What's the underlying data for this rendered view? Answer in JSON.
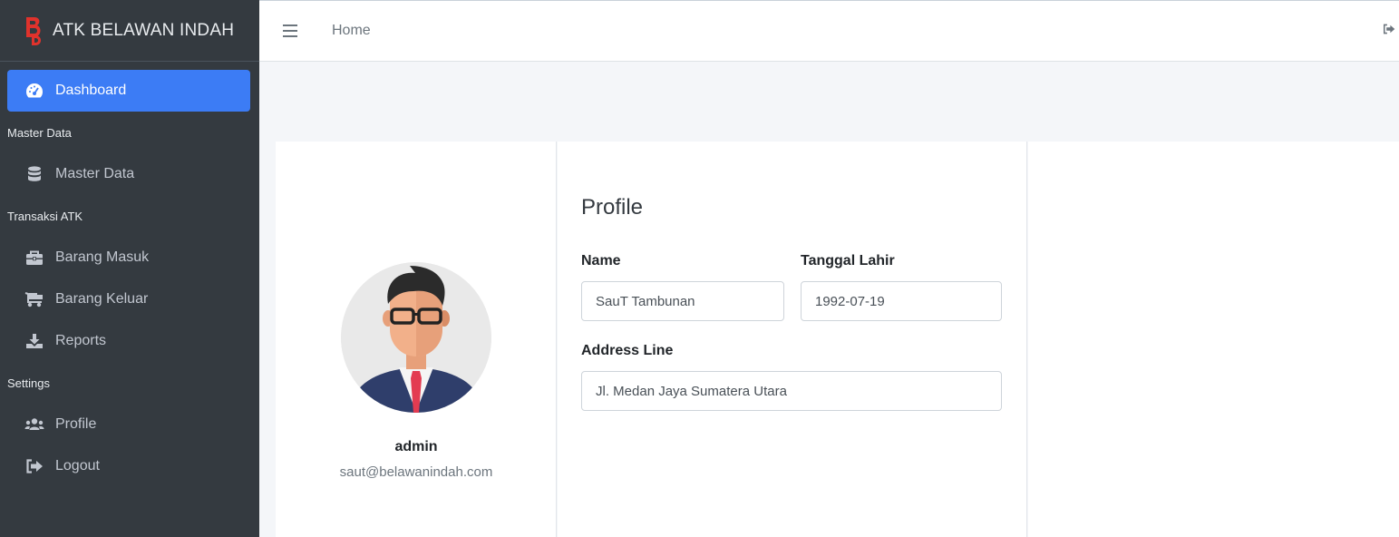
{
  "brand": {
    "name": "ATK BELAWAN INDAH",
    "logo_color": "#e0322c"
  },
  "sidebar": {
    "items": [
      {
        "type": "item",
        "label": "Dashboard",
        "icon": "tachometer-icon",
        "active": true
      },
      {
        "type": "header",
        "label": "Master Data"
      },
      {
        "type": "item",
        "label": "Master Data",
        "icon": "database-icon"
      },
      {
        "type": "header",
        "label": "Transaksi ATK"
      },
      {
        "type": "item",
        "label": "Barang Masuk",
        "icon": "briefcase-icon"
      },
      {
        "type": "item",
        "label": "Barang Keluar",
        "icon": "dolly-icon"
      },
      {
        "type": "item",
        "label": "Reports",
        "icon": "download-icon"
      },
      {
        "type": "header",
        "label": "Settings"
      },
      {
        "type": "item",
        "label": "Profile",
        "icon": "users-icon"
      },
      {
        "type": "item",
        "label": "Logout",
        "icon": "sign-out-icon"
      }
    ]
  },
  "topbar": {
    "home_label": "Home",
    "menu_icon": "bars-icon",
    "logout_icon": "sign-out-icon"
  },
  "user": {
    "name": "admin",
    "email": "saut@belawanindah.com"
  },
  "profile": {
    "title": "Profile",
    "name_label": "Name",
    "name_value": "SauT Tambunan",
    "dob_label": "Tanggal Lahir",
    "dob_value": "1992-07-19",
    "address_label": "Address Line",
    "address_value": "Jl. Medan Jaya Sumatera Utara"
  },
  "colors": {
    "sidebar_bg": "#343a40",
    "accent": "#3c7cf5",
    "page_bg": "#f4f6f9"
  }
}
